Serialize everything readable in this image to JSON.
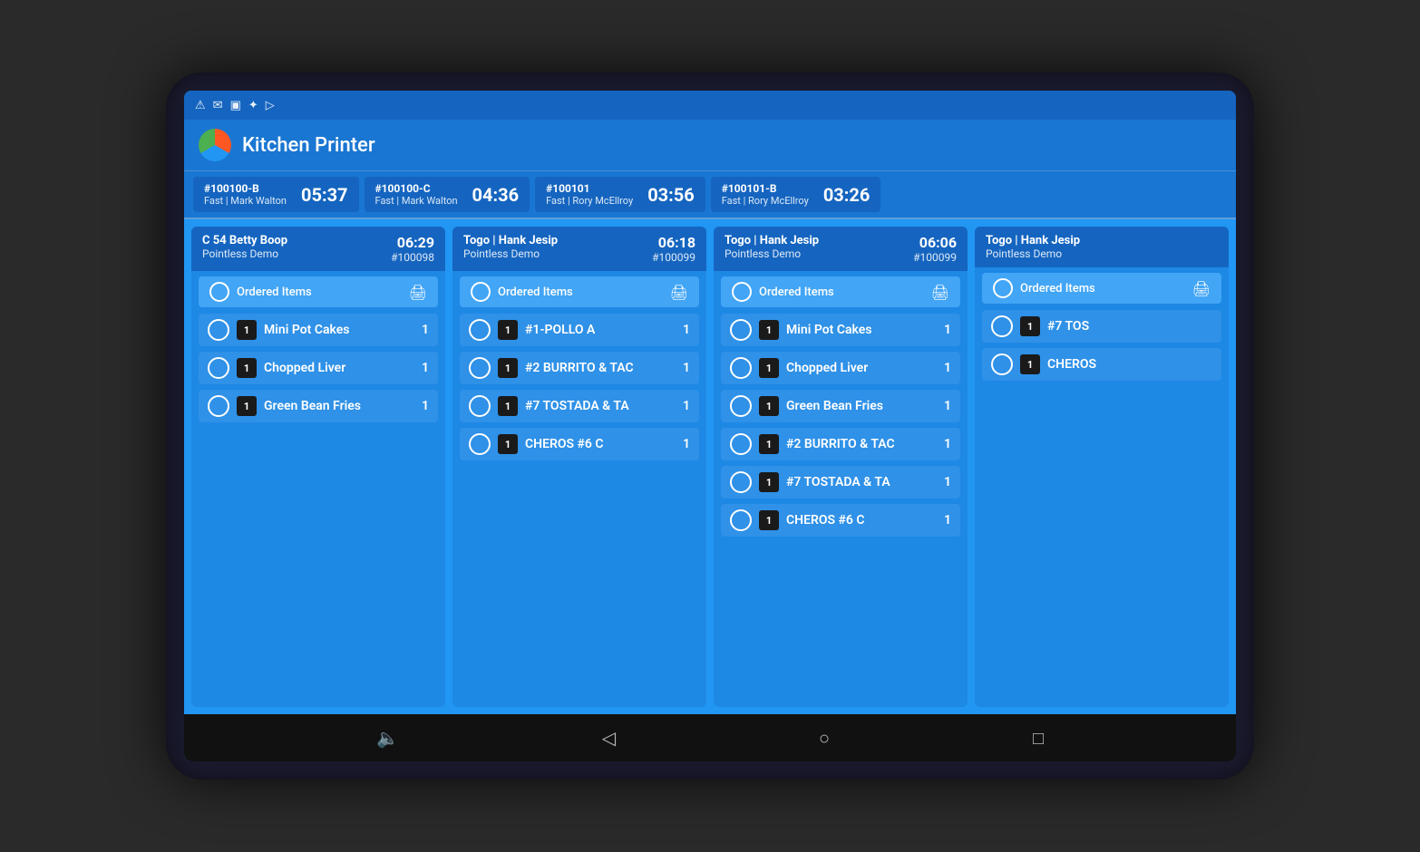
{
  "app": {
    "title": "Kitchen Printer"
  },
  "statusBar": {
    "icons": [
      "⚠",
      "✉",
      "🖼",
      "📌",
      "▷"
    ]
  },
  "orderTabs": [
    {
      "id": "#100100-B",
      "server": "Fast | Mark Walton",
      "timer": "05:37"
    },
    {
      "id": "#100100-C",
      "server": "Fast | Mark Walton",
      "timer": "04:36"
    },
    {
      "id": "#100101",
      "server": "Fast | Rory McEllroy",
      "timer": "03:56"
    },
    {
      "id": "#100101-B",
      "server": "Fast | Rory McEllroy",
      "timer": "03:26"
    }
  ],
  "orderCards": [
    {
      "title": "C 54 Betty Boop",
      "demo": "Pointless Demo",
      "time": "06:29",
      "num": "#100098",
      "items": [
        {
          "badge": "1",
          "name": "Mini Pot Cakes",
          "qty": "1"
        },
        {
          "badge": "1",
          "name": "Chopped Liver",
          "qty": "1"
        },
        {
          "badge": "1",
          "name": "Green Bean Fries",
          "qty": "1"
        }
      ]
    },
    {
      "title": "Togo | Hank Jesip",
      "demo": "Pointless Demo",
      "time": "06:18",
      "num": "#100099",
      "items": [
        {
          "badge": "1",
          "name": "#1-POLLO A",
          "qty": "1"
        },
        {
          "badge": "1",
          "name": "#2 BURRITO & TAC",
          "qty": "1"
        },
        {
          "badge": "1",
          "name": "#7 TOSTADA & TA",
          "qty": "1"
        },
        {
          "badge": "1",
          "name": "CHEROS   #6 C",
          "qty": "1"
        }
      ]
    },
    {
      "title": "Togo | Hank Jesip",
      "demo": "Pointless Demo",
      "time": "06:06",
      "num": "#100099",
      "items": [
        {
          "badge": "1",
          "name": "Mini Pot Cakes",
          "qty": "1"
        },
        {
          "badge": "1",
          "name": "Chopped Liver",
          "qty": "1"
        },
        {
          "badge": "1",
          "name": "Green Bean Fries",
          "qty": "1"
        },
        {
          "badge": "1",
          "name": "#2 BURRITO & TAC",
          "qty": "1"
        },
        {
          "badge": "1",
          "name": "#7 TOSTADA & TA",
          "qty": "1"
        },
        {
          "badge": "1",
          "name": "CHEROS   #6 C",
          "qty": "1"
        }
      ]
    },
    {
      "title": "Togo | Hank Jesip",
      "demo": "Pointless Demo",
      "time": "",
      "num": "",
      "items": [
        {
          "badge": "1",
          "name": "#7 TOS",
          "qty": ""
        },
        {
          "badge": "1",
          "name": "CHEROS",
          "qty": ""
        }
      ]
    }
  ],
  "bottomNav": {
    "volume": "🔈",
    "back": "◁",
    "home": "○",
    "recent": "□"
  },
  "labels": {
    "orderedItems": "Ordered Items"
  }
}
